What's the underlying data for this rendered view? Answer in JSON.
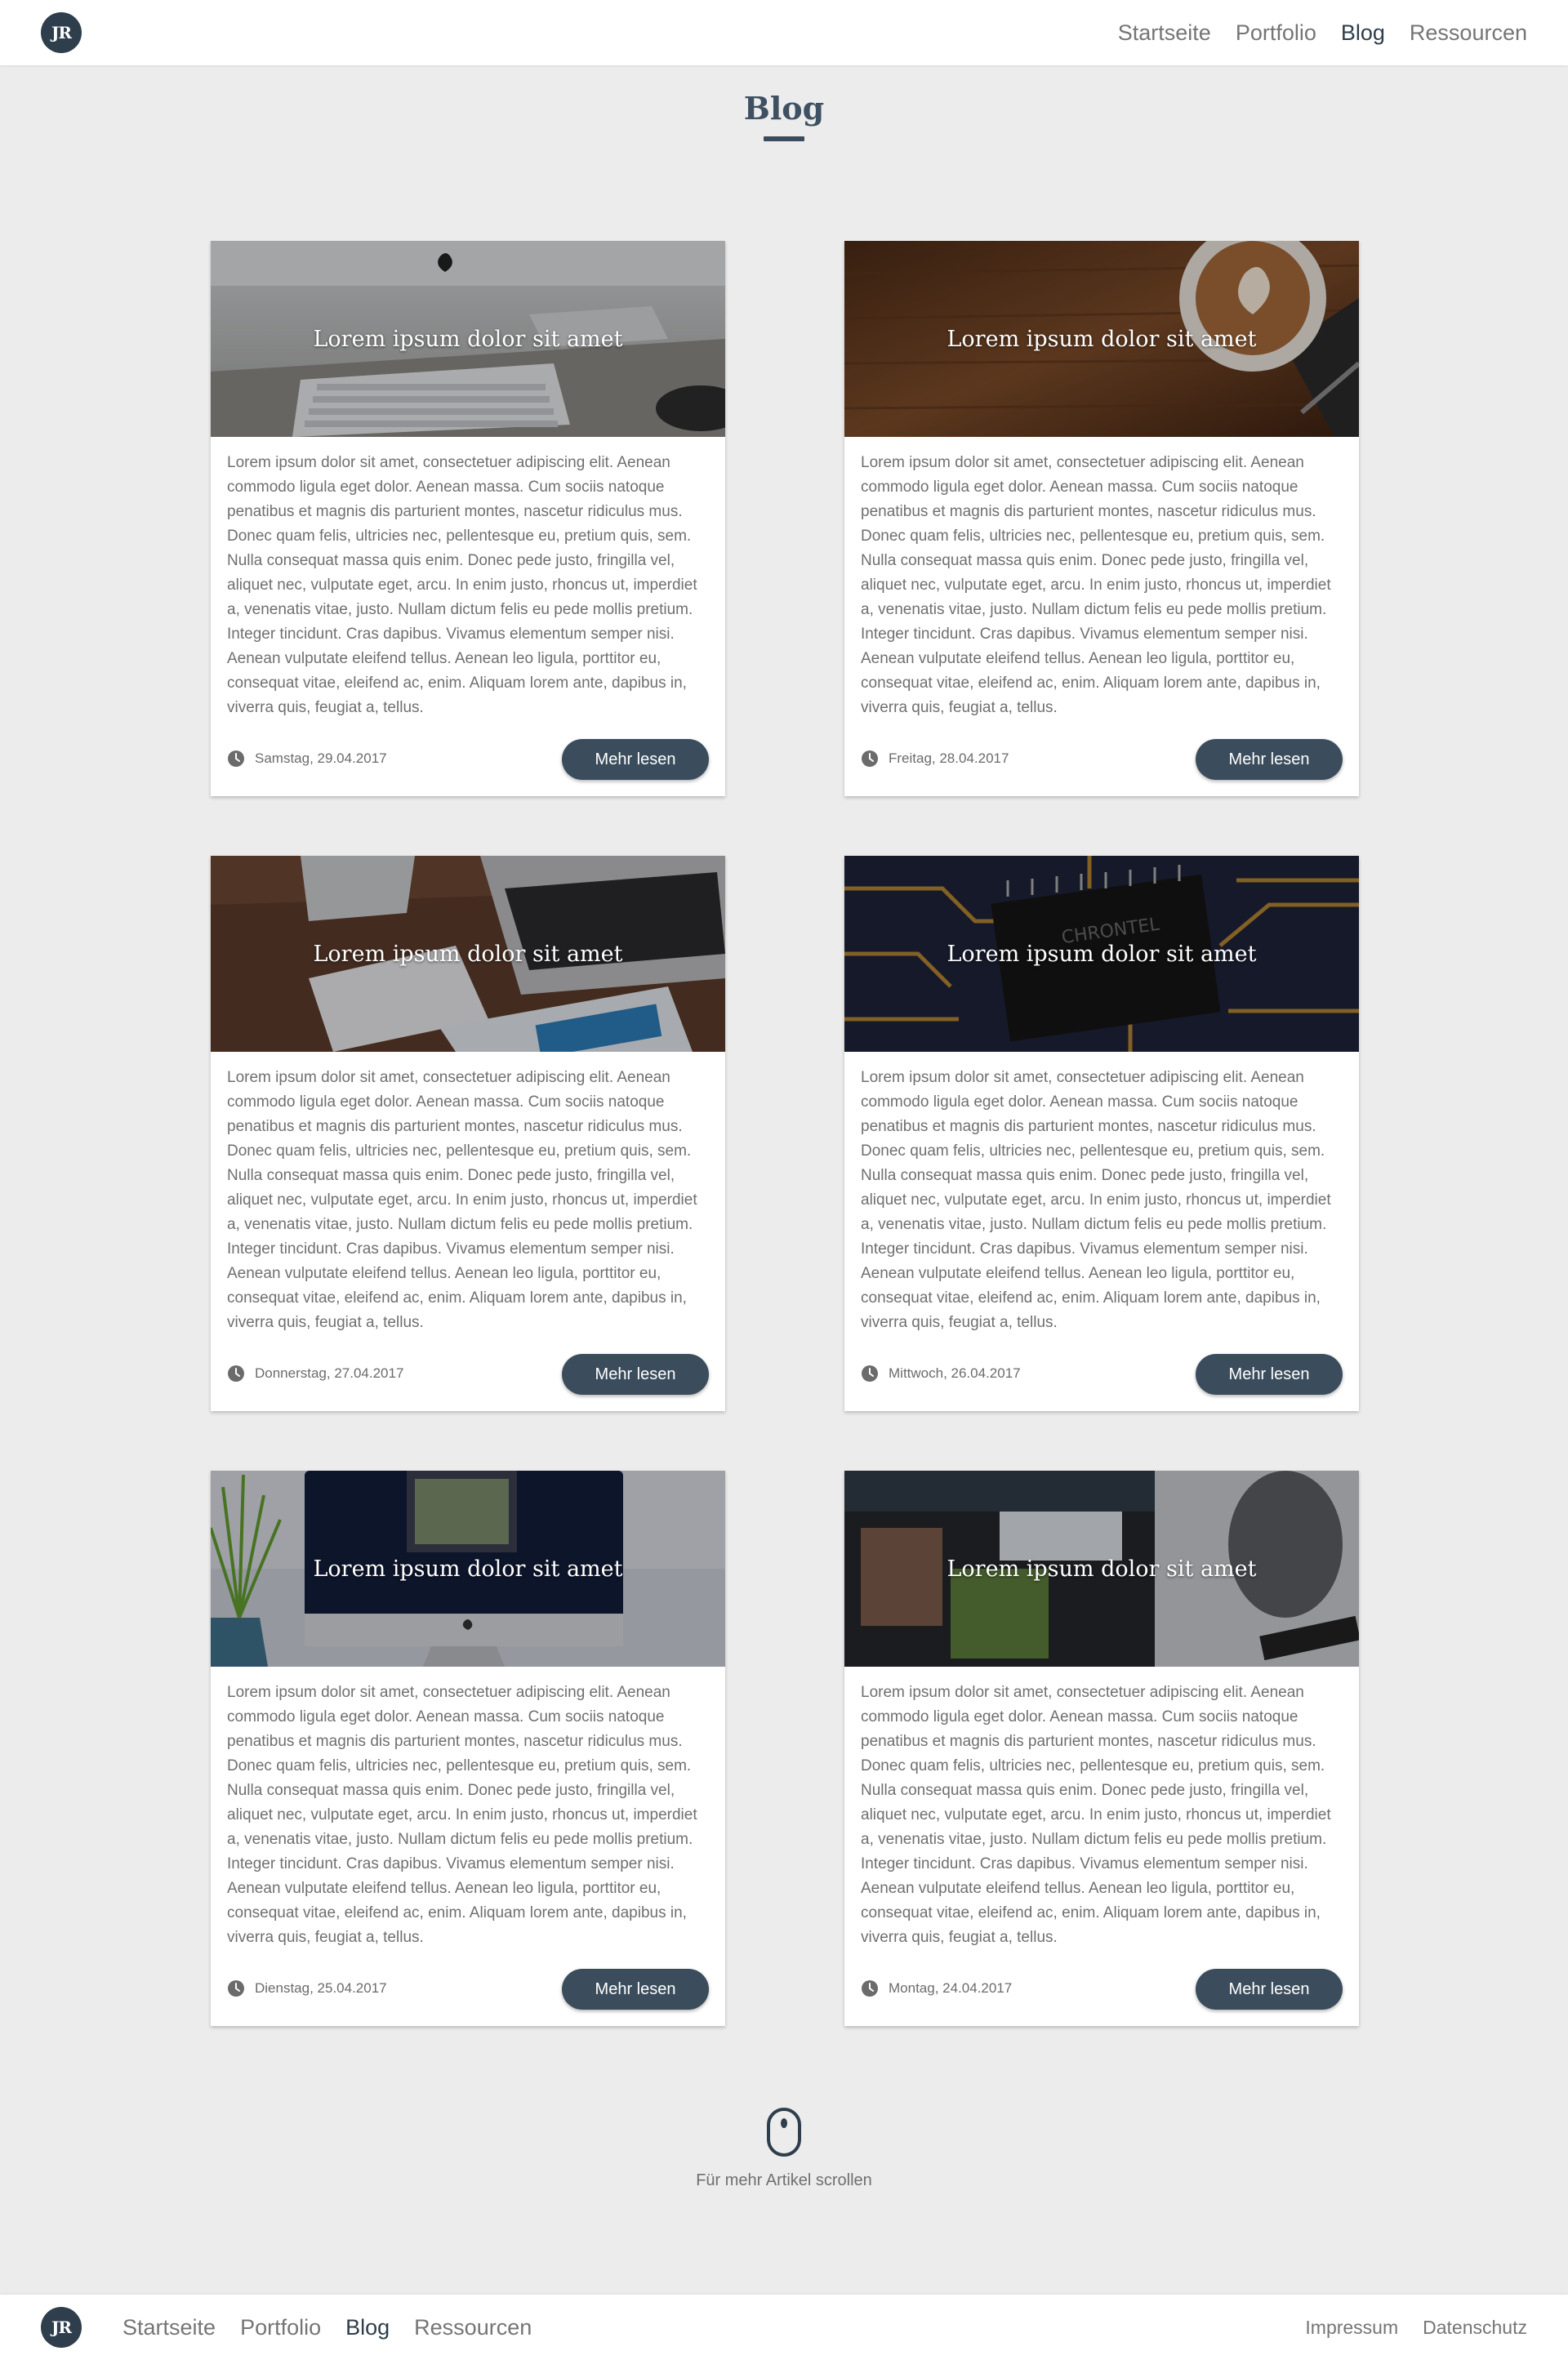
{
  "header": {
    "logo_text": "JR",
    "nav": [
      "Startseite",
      "Portfolio",
      "Blog",
      "Ressourcen"
    ],
    "active": "Blog"
  },
  "page": {
    "title": "Blog"
  },
  "posts": [
    {
      "title": "Lorem ipsum dolor sit amet",
      "image": "imac-keyboard-photo",
      "text": "Lorem ipsum dolor sit amet, consectetuer adipiscing elit. Aenean commodo ligula eget dolor. Aenean massa. Cum sociis natoque penatibus et magnis dis parturient montes, nascetur ridiculus mus. Donec quam felis, ultricies nec, pellentesque eu, pretium quis, sem. Nulla consequat massa quis enim. Donec pede justo, fringilla vel, aliquet nec, vulputate eget, arcu. In enim justo, rhoncus ut, imperdiet a, venenatis vitae, justo. Nullam dictum felis eu pede mollis pretium. Integer tincidunt. Cras dapibus. Vivamus elementum semper nisi. Aenean vulputate eleifend tellus. Aenean leo ligula, porttitor eu, consequat vitae, eleifend ac, enim. Aliquam lorem ante, dapibus in, viverra quis, feugiat a, tellus.",
      "date": "Samstag, 29.04.2017",
      "button": "Mehr lesen"
    },
    {
      "title": "Lorem ipsum dolor sit amet",
      "image": "coffee-on-wood-photo",
      "text": "Lorem ipsum dolor sit amet, consectetuer adipiscing elit. Aenean commodo ligula eget dolor. Aenean massa. Cum sociis natoque penatibus et magnis dis parturient montes, nascetur ridiculus mus. Donec quam felis, ultricies nec, pellentesque eu, pretium quis, sem. Nulla consequat massa quis enim. Donec pede justo, fringilla vel, aliquet nec, vulputate eget, arcu. In enim justo, rhoncus ut, imperdiet a, venenatis vitae, justo. Nullam dictum felis eu pede mollis pretium. Integer tincidunt. Cras dapibus. Vivamus elementum semper nisi. Aenean vulputate eleifend tellus. Aenean leo ligula, porttitor eu, consequat vitae, eleifend ac, enim. Aliquam lorem ante, dapibus in, viverra quis, feugiat a, tellus.",
      "date": "Freitag, 28.04.2017",
      "button": "Mehr lesen"
    },
    {
      "title": "Lorem ipsum dolor sit amet",
      "image": "desk-laptop-keyboard-photo",
      "text": "Lorem ipsum dolor sit amet, consectetuer adipiscing elit. Aenean commodo ligula eget dolor. Aenean massa. Cum sociis natoque penatibus et magnis dis parturient montes, nascetur ridiculus mus. Donec quam felis, ultricies nec, pellentesque eu, pretium quis, sem. Nulla consequat massa quis enim. Donec pede justo, fringilla vel, aliquet nec, vulputate eget, arcu. In enim justo, rhoncus ut, imperdiet a, venenatis vitae, justo. Nullam dictum felis eu pede mollis pretium. Integer tincidunt. Cras dapibus. Vivamus elementum semper nisi. Aenean vulputate eleifend tellus. Aenean leo ligula, porttitor eu, consequat vitae, eleifend ac, enim. Aliquam lorem ante, dapibus in, viverra quis, feugiat a, tellus.",
      "date": "Donnerstag, 27.04.2017",
      "button": "Mehr lesen"
    },
    {
      "title": "Lorem ipsum dolor sit amet",
      "image": "circuit-board-chip-photo",
      "text": "Lorem ipsum dolor sit amet, consectetuer adipiscing elit. Aenean commodo ligula eget dolor. Aenean massa. Cum sociis natoque penatibus et magnis dis parturient montes, nascetur ridiculus mus. Donec quam felis, ultricies nec, pellentesque eu, pretium quis, sem. Nulla consequat massa quis enim. Donec pede justo, fringilla vel, aliquet nec, vulputate eget, arcu. In enim justo, rhoncus ut, imperdiet a, venenatis vitae, justo. Nullam dictum felis eu pede mollis pretium. Integer tincidunt. Cras dapibus. Vivamus elementum semper nisi. Aenean vulputate eleifend tellus. Aenean leo ligula, porttitor eu, consequat vitae, eleifend ac, enim. Aliquam lorem ante, dapibus in, viverra quis, feugiat a, tellus.",
      "date": "Mittwoch, 26.04.2017",
      "button": "Mehr lesen"
    },
    {
      "title": "Lorem ipsum dolor sit amet",
      "image": "imac-plant-photo",
      "text": "Lorem ipsum dolor sit amet, consectetuer adipiscing elit. Aenean commodo ligula eget dolor. Aenean massa. Cum sociis natoque penatibus et magnis dis parturient montes, nascetur ridiculus mus. Donec quam felis, ultricies nec, pellentesque eu, pretium quis, sem. Nulla consequat massa quis enim. Donec pede justo, fringilla vel, aliquet nec, vulputate eget, arcu. In enim justo, rhoncus ut, imperdiet a, venenatis vitae, justo. Nullam dictum felis eu pede mollis pretium. Integer tincidunt. Cras dapibus. Vivamus elementum semper nisi. Aenean vulputate eleifend tellus. Aenean leo ligula, porttitor eu, consequat vitae, eleifend ac, enim. Aliquam lorem ante, dapibus in, viverra quis, feugiat a, tellus.",
      "date": "Dienstag, 25.04.2017",
      "button": "Mehr lesen"
    },
    {
      "title": "Lorem ipsum dolor sit amet",
      "image": "laptop-twitter-photo",
      "text": "Lorem ipsum dolor sit amet, consectetuer adipiscing elit. Aenean commodo ligula eget dolor. Aenean massa. Cum sociis natoque penatibus et magnis dis parturient montes, nascetur ridiculus mus. Donec quam felis, ultricies nec, pellentesque eu, pretium quis, sem. Nulla consequat massa quis enim. Donec pede justo, fringilla vel, aliquet nec, vulputate eget, arcu. In enim justo, rhoncus ut, imperdiet a, venenatis vitae, justo. Nullam dictum felis eu pede mollis pretium. Integer tincidunt. Cras dapibus. Vivamus elementum semper nisi. Aenean vulputate eleifend tellus. Aenean leo ligula, porttitor eu, consequat vitae, eleifend ac, enim. Aliquam lorem ante, dapibus in, viverra quis, feugiat a, tellus.",
      "date": "Montag, 24.04.2017",
      "button": "Mehr lesen"
    }
  ],
  "scroll_hint": {
    "icon": "mouse-icon",
    "text": "Für mehr Artikel scrollen"
  },
  "footer": {
    "logo_text": "JR",
    "nav": [
      "Startseite",
      "Portfolio",
      "Blog",
      "Ressourcen"
    ],
    "active": "Blog",
    "legal": [
      "Impressum",
      "Datenschutz"
    ]
  },
  "colors": {
    "primary": "#3b4d5d",
    "logo_bg": "#2e3e4c",
    "background": "#ececec",
    "text": "#6f6f6f"
  }
}
